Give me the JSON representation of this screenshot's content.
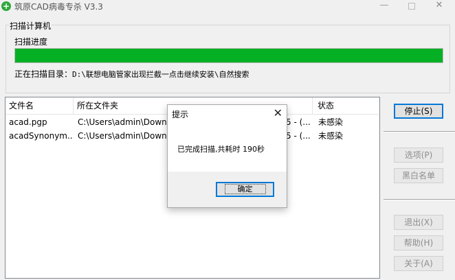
{
  "window": {
    "title": "筑原CAD病毒专杀  V3.3",
    "icon": "plus-cross-icon",
    "minimize_glyph": "—",
    "close_glyph": "✕"
  },
  "scan": {
    "group_label": "扫描计算机",
    "progress_label": "扫描进度",
    "progress_percent": 100,
    "progress_color": "#06b025",
    "dir_prefix": "正在扫描目录：",
    "dir_path": "D:\\联想电脑管家出现拦截一点击继续安装\\自然搜索"
  },
  "table": {
    "columns": [
      "文件名",
      "所在文件夹",
      "状态"
    ],
    "rows": [
      {
        "name": "acad.pgp",
        "folder": "C:\\Users\\admin\\Downl",
        "folder_tail": "5 - (...",
        "status": "未感染"
      },
      {
        "name": "acadSynonym...",
        "folder": "C:\\Users\\admin\\Downl",
        "folder_tail": "5 - (...",
        "status": "未感染"
      }
    ]
  },
  "buttons": {
    "stop": "停止(S)",
    "options": "选项(P)",
    "blacklist": "黑白名单",
    "exit": "退出(X)",
    "help": "帮助(H)",
    "about": "关于(A)"
  },
  "dialog": {
    "title": "提示",
    "message": "已完成扫描,共耗时 190秒",
    "ok": "确定",
    "close_glyph": "✕"
  }
}
